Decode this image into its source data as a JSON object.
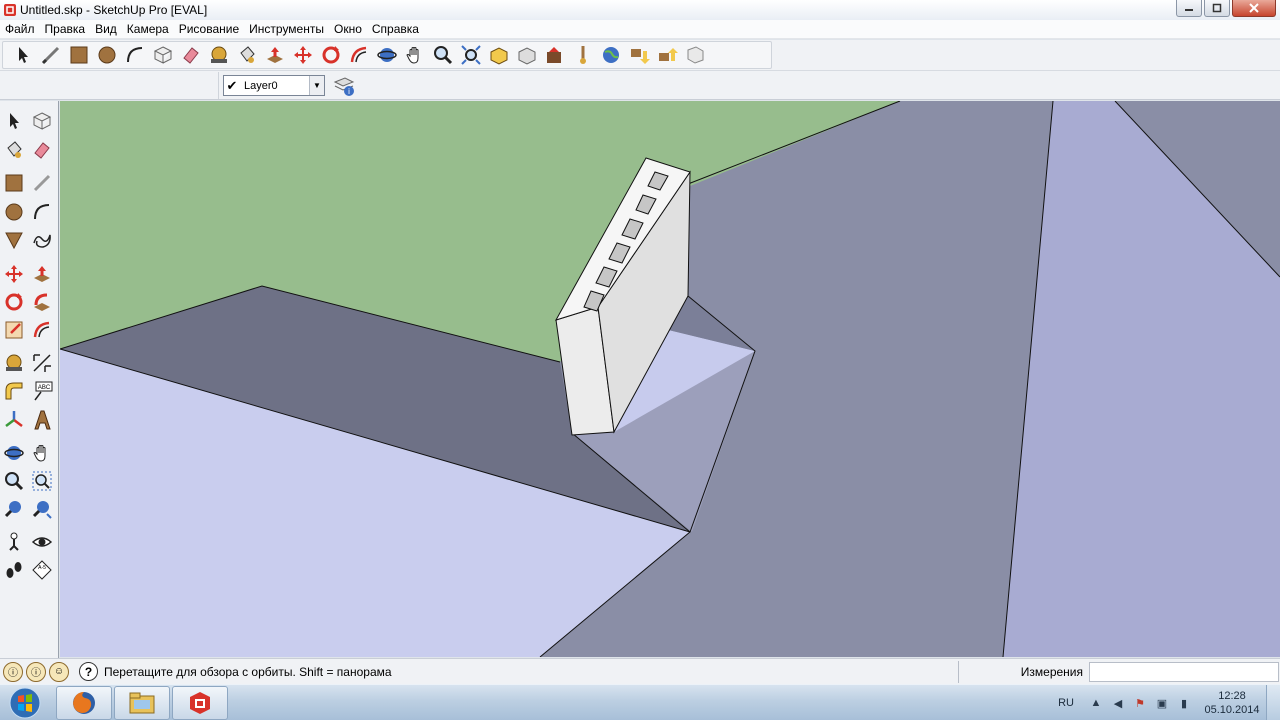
{
  "window": {
    "title": "Untitled.skp - SketchUp Pro [EVAL]",
    "controls": [
      "minimize-icon",
      "maximize-icon",
      "close-icon"
    ]
  },
  "menu": [
    "Файл",
    "Правка",
    "Вид",
    "Камера",
    "Рисование",
    "Инструменты",
    "Окно",
    "Справка"
  ],
  "toolbar_top": [
    "select-icon",
    "line-icon",
    "rectangle-icon",
    "circle-icon",
    "arc-icon",
    "make-component-icon",
    "eraser-icon",
    "tape-measure-icon",
    "paint-bucket-icon",
    "push-pull-icon",
    "move-icon",
    "rotate-icon",
    "offset-icon",
    "orbit-icon",
    "pan-icon",
    "zoom-icon",
    "zoom-extents-icon",
    "3d-warehouse-icon",
    "share-model-icon",
    "extension-warehouse-icon",
    "add-location-icon",
    "preview-google-earth-icon",
    "get-models-icon",
    "share-component-icon",
    "send-to-layout-icon"
  ],
  "layers": {
    "current": "Layer0"
  },
  "toolbar_left": [
    "select-icon",
    "make-component-icon",
    "paint-bucket-icon",
    "eraser-icon",
    "rectangle-icon",
    "line-icon",
    "circle-icon",
    "arc-icon",
    "polygon-icon",
    "freehand-icon",
    "move-icon",
    "push-pull-icon",
    "rotate-icon",
    "follow-me-icon",
    "scale-icon",
    "offset-icon",
    "tape-measure-icon",
    "dimension-icon",
    "protractor-icon",
    "text-icon",
    "axes-icon",
    "3d-text-icon",
    "orbit-icon",
    "pan-icon",
    "zoom-icon",
    "zoom-window-icon",
    "previous-view-icon",
    "zoom-extents-icon",
    "position-camera-icon",
    "look-around-icon",
    "walk-icon",
    "section-plane-icon"
  ],
  "status": {
    "message": "Перетащите для обзора с орбиты.  Shift = панорама",
    "measurements_label": "Измерения",
    "measurements_value": ""
  },
  "taskbar": {
    "apps": [
      "firefox-icon",
      "explorer-icon",
      "sketchup-icon"
    ],
    "lang": "RU",
    "time": "12:28",
    "date": "05.10.2014"
  },
  "colors": {
    "sky": "#97bd8d",
    "ground_light": "#c9cdee",
    "ground_dark": "#8a8ea6",
    "shadow": "#6e7186",
    "block": "#eeeeee"
  }
}
